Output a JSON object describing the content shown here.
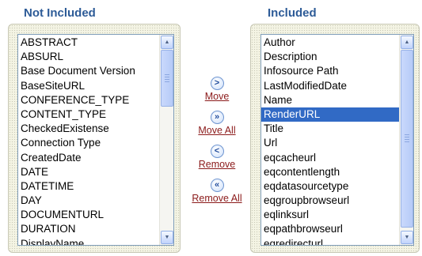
{
  "left": {
    "heading": "Not Included",
    "items": [
      "ABSTRACT",
      "ABSURL",
      "Base Document Version",
      "BaseSiteURL",
      "CONFERENCE_TYPE",
      "CONTENT_TYPE",
      "CheckedExistense",
      "Connection Type",
      "CreatedDate",
      "DATE",
      "DATETIME",
      "DAY",
      "DOCUMENTURL",
      "DURATION",
      "DisplayName"
    ]
  },
  "right": {
    "heading": "Included",
    "items": [
      "Author",
      "Description",
      "Infosource Path",
      "LastModifiedDate",
      "Name",
      "RenderURL",
      "Title",
      "Url",
      "eqcacheurl",
      "eqcontentlength",
      "eqdatasourcetype",
      "eqgroupbrowseurl",
      "eqlinksurl",
      "eqpathbrowseurl",
      "eqredirecturl"
    ],
    "selected_item": "RenderURL"
  },
  "actions": {
    "move": {
      "label": "Move",
      "icon": "chevron-right-icon",
      "glyph": ">"
    },
    "move_all": {
      "label": "Move All",
      "icon": "double-chevron-right-icon",
      "glyph": "»"
    },
    "remove": {
      "label": "Remove",
      "icon": "chevron-left-icon",
      "glyph": "<"
    },
    "remove_all": {
      "label": "Remove All",
      "icon": "double-chevron-left-icon",
      "glyph": "«"
    }
  },
  "colors": {
    "heading": "#2d5b97",
    "link": "#8b1a1a",
    "selection": "#316ac5",
    "panel": "#f4f4e4"
  }
}
